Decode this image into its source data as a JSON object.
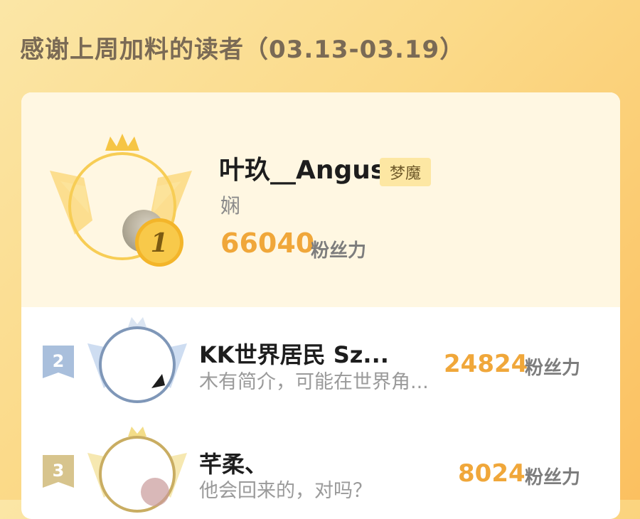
{
  "header": {
    "title": "感谢上周加料的读者（03.13-03.19）"
  },
  "readers": [
    {
      "rank": "1",
      "name": "叶玖__Angus",
      "badge": "梦魔",
      "bio": "娴",
      "score": "66040",
      "unit": "粉丝力"
    },
    {
      "rank": "2",
      "name": "KK世界居民  Sz...",
      "bio": "木有简介，可能在世界角...",
      "score": "24824",
      "unit": "粉丝力"
    },
    {
      "rank": "3",
      "name": "芊柔、",
      "bio": "他会回来的，对吗？",
      "score": "8024",
      "unit": "粉丝力"
    }
  ],
  "colors": {
    "accent_gold": "#f0a73a",
    "silver": "#8aa6c8",
    "bronze": "#c9ad62",
    "badge_bg": "#fde7a3"
  }
}
